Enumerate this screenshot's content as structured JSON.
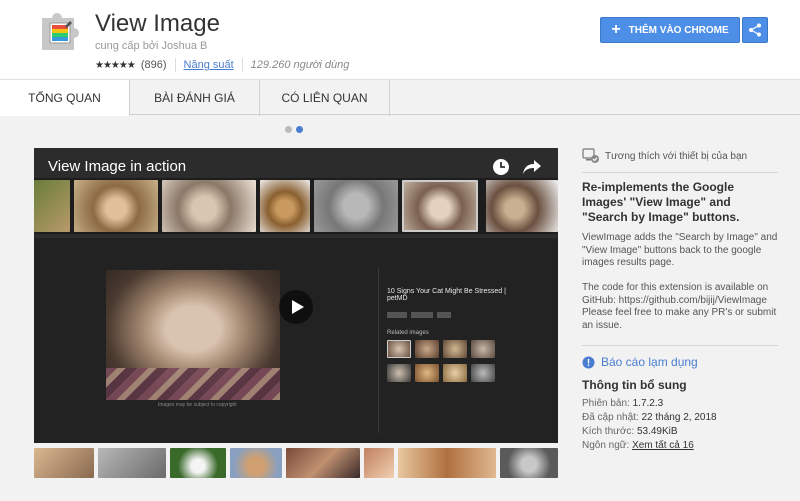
{
  "header": {
    "title": "View Image",
    "offered_by": "cung cấp bởi Joshua B",
    "stars": "★★★★★",
    "rating_count": "(896)",
    "category": "Năng suất",
    "users": "129.260 người dùng",
    "add_button": "THÊM VÀO CHROME",
    "colors": {
      "button": "#4d8fe6",
      "link": "#4a7dd0"
    }
  },
  "tabs": [
    {
      "label": "TỔNG QUAN",
      "active": true
    },
    {
      "label": "BÀI ĐÁNH GIÁ",
      "active": false
    },
    {
      "label": "CÓ LIÊN QUAN",
      "active": false
    }
  ],
  "carousel": {
    "slides": 2,
    "current": 2
  },
  "video": {
    "title": "View Image in action",
    "result_title": "10 Signs Your Cat Might Be Stressed | petMD",
    "related_label": "Related images",
    "caption": "Images may be subject to copyright"
  },
  "sidebar": {
    "compat": "Tương thích với thiết bị của bạn",
    "summary": "Re-implements the Google Images' \"View Image\" and \"Search by Image\" buttons.",
    "desc1": "ViewImage adds the \"Search by Image\" and \"View Image\" buttons back to the google images results page.",
    "desc2": "The code for this extension is available on GitHub: https://github.com/bijij/ViewImage Please feel free to make any PR's or submit an issue.",
    "report": "Báo cáo lạm dụng",
    "info_heading": "Thông tin bổ sung",
    "version_label": "Phiên bản:",
    "version": "1.7.2.3",
    "updated_label": "Đã cập nhật:",
    "updated": "22 tháng 2, 2018",
    "size_label": "Kích thước:",
    "size": "53.49KiB",
    "lang_label": "Ngôn ngữ:",
    "lang": "Xem tất cả 16"
  }
}
